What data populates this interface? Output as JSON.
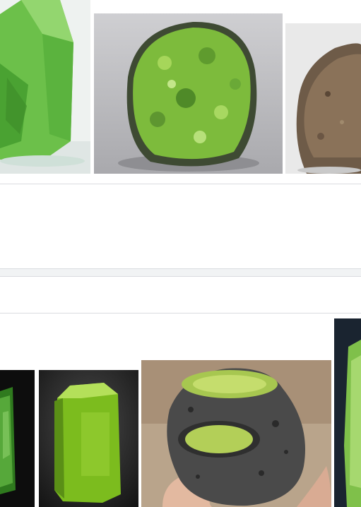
{
  "results": {
    "top_row": [
      {
        "subject": "peridot-crystal-on-white",
        "selected": false
      },
      {
        "subject": "peridot-granular-nodule",
        "selected": false
      },
      {
        "subject": "brown-rock-specimen",
        "selected": false
      }
    ],
    "bottom_row": [
      {
        "subject": "dark-peridot-crystal",
        "selected": false
      },
      {
        "subject": "bright-peridot-prism",
        "selected": false
      },
      {
        "subject": "peridot-in-basalt-hand",
        "selected": false
      },
      {
        "subject": "peridot-crystal-dark-bg",
        "selected": false
      }
    ]
  },
  "colors": {
    "divider": "#dadce0",
    "band": "#f1f3f4",
    "peridot": "#7cc241",
    "basalt": "#3d3d3d"
  }
}
